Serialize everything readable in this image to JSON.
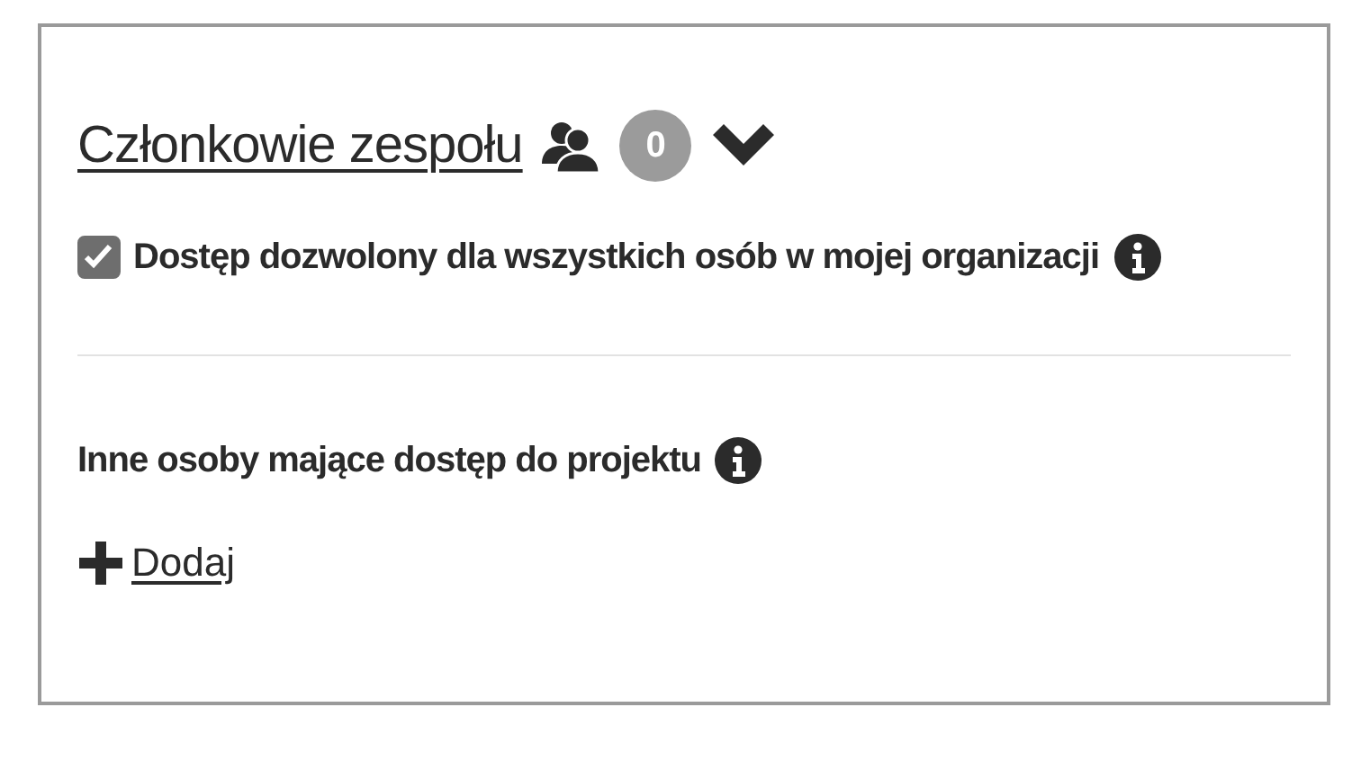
{
  "team_members": {
    "title": "Członkowie zespołu",
    "count": "0",
    "expanded": false
  },
  "allow_all": {
    "label": "Dostęp dozwolony dla wszystkich osób w mojej organizacji",
    "checked": true
  },
  "others": {
    "heading": "Inne osoby mające dostęp do projektu",
    "add_link": "Dodaj"
  }
}
